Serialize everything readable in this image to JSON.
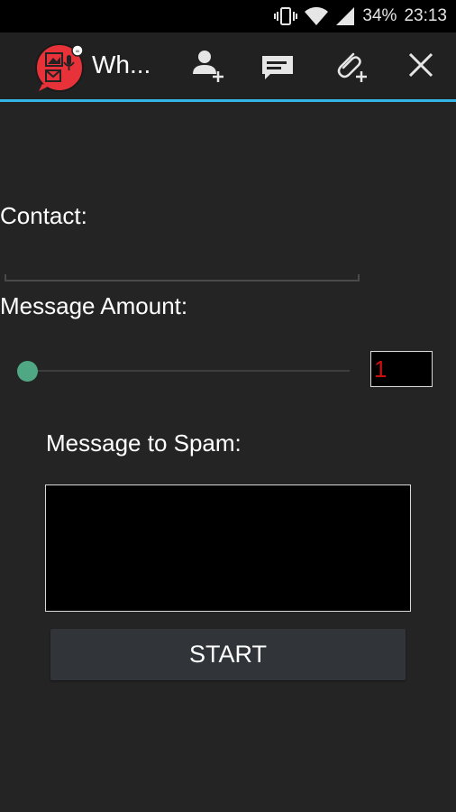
{
  "status_bar": {
    "battery": "34%",
    "time": "23:13",
    "icons": [
      "vibrate-icon",
      "wifi-icon",
      "signal-icon"
    ]
  },
  "action_bar": {
    "title": "Wh...",
    "logo": "app-logo-icon",
    "actions": [
      "add-contact-icon",
      "message-icon",
      "attach-icon",
      "close-icon"
    ],
    "accent_color": "#33b5e5"
  },
  "form": {
    "contact_label": "Contact:",
    "contact_value": "",
    "amount_label": "Message Amount:",
    "amount_value": "1",
    "amount_color": "#cc1010",
    "slider_color": "#4fa784",
    "slider_value": 1,
    "message_label": "Message to Spam:",
    "message_value": "",
    "start_label": "START"
  }
}
